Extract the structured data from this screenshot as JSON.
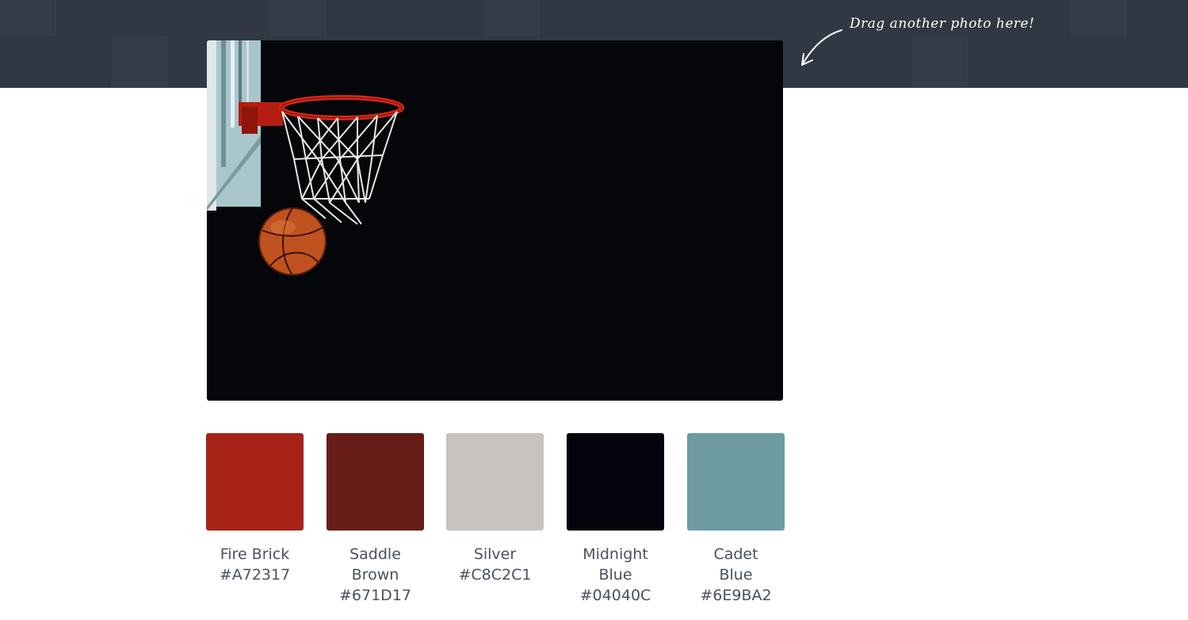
{
  "header": {
    "drag_hint": "Drag another photo here!",
    "background_color": "#323843"
  },
  "photo": {
    "description_icon": "basketball-hoop-photo",
    "background_color": "#05060A"
  },
  "palette": [
    {
      "name": "Fire Brick",
      "hex": "#A72317",
      "color": "#A72317"
    },
    {
      "name": "Saddle Brown",
      "hex": "#671D17",
      "color": "#671D17"
    },
    {
      "name": "Silver",
      "hex": "#C8C2C1",
      "color": "#C8C2C1"
    },
    {
      "name": "Midnight Blue",
      "hex": "#04040C",
      "color": "#04040C"
    },
    {
      "name": "Cadet Blue",
      "hex": "#6E9BA2",
      "color": "#6E9BA2"
    }
  ]
}
